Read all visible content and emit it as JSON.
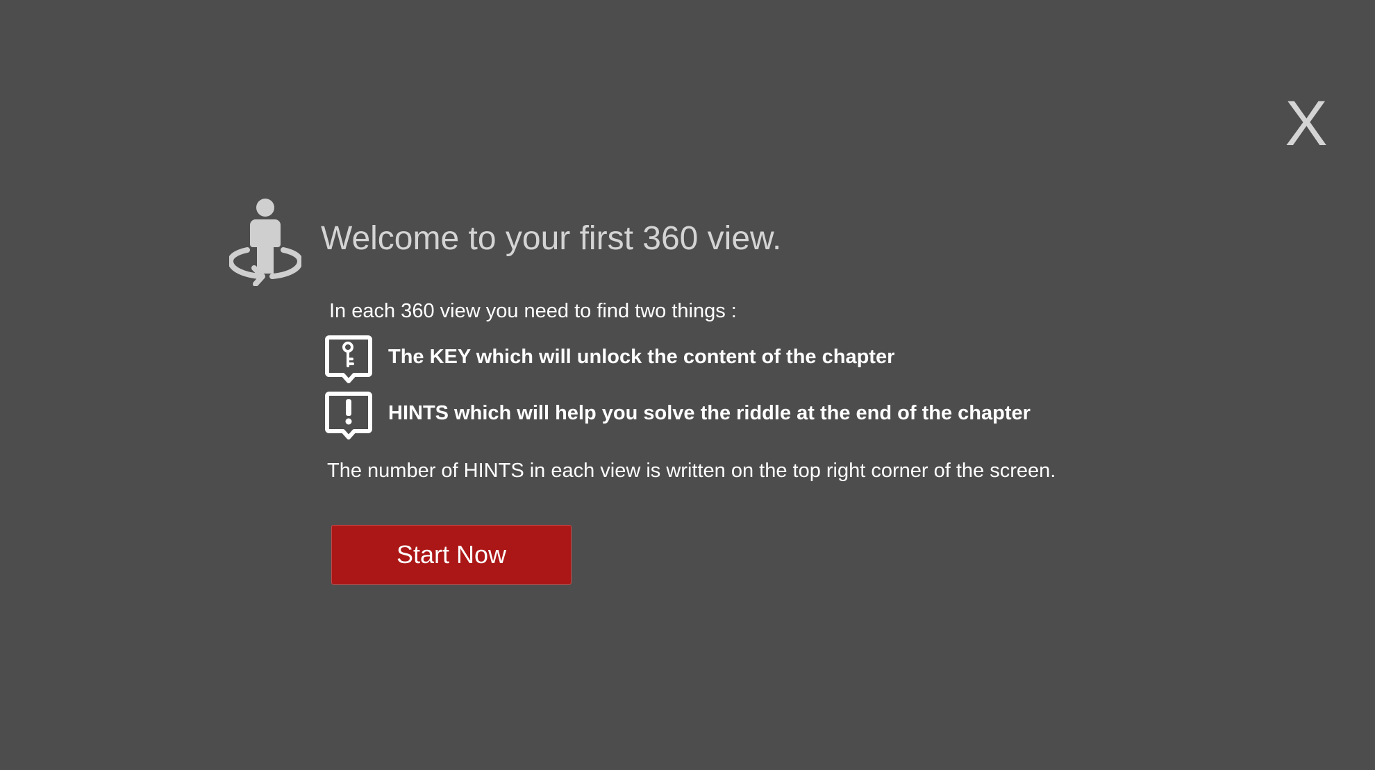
{
  "close_button": {
    "label": "X"
  },
  "header": {
    "icon": "person-360-rotate-icon",
    "title": "Welcome to your first 360 view."
  },
  "intro": "In each 360 view you need to find two things :",
  "items": [
    {
      "icon": "key-bubble-icon",
      "label": "The KEY which will unlock the content of the chapter"
    },
    {
      "icon": "exclamation-bubble-icon",
      "label": "HINTS which will help you solve the riddle at the end of the chapter"
    }
  ],
  "note": "The number of HINTS in each view is written on the top right corner of the screen.",
  "start_button": {
    "label": "Start Now"
  },
  "colors": {
    "background": "#4d4d4d",
    "title_text": "#d4d4d4",
    "body_text": "#ffffff",
    "accent_button": "#ab1717"
  }
}
